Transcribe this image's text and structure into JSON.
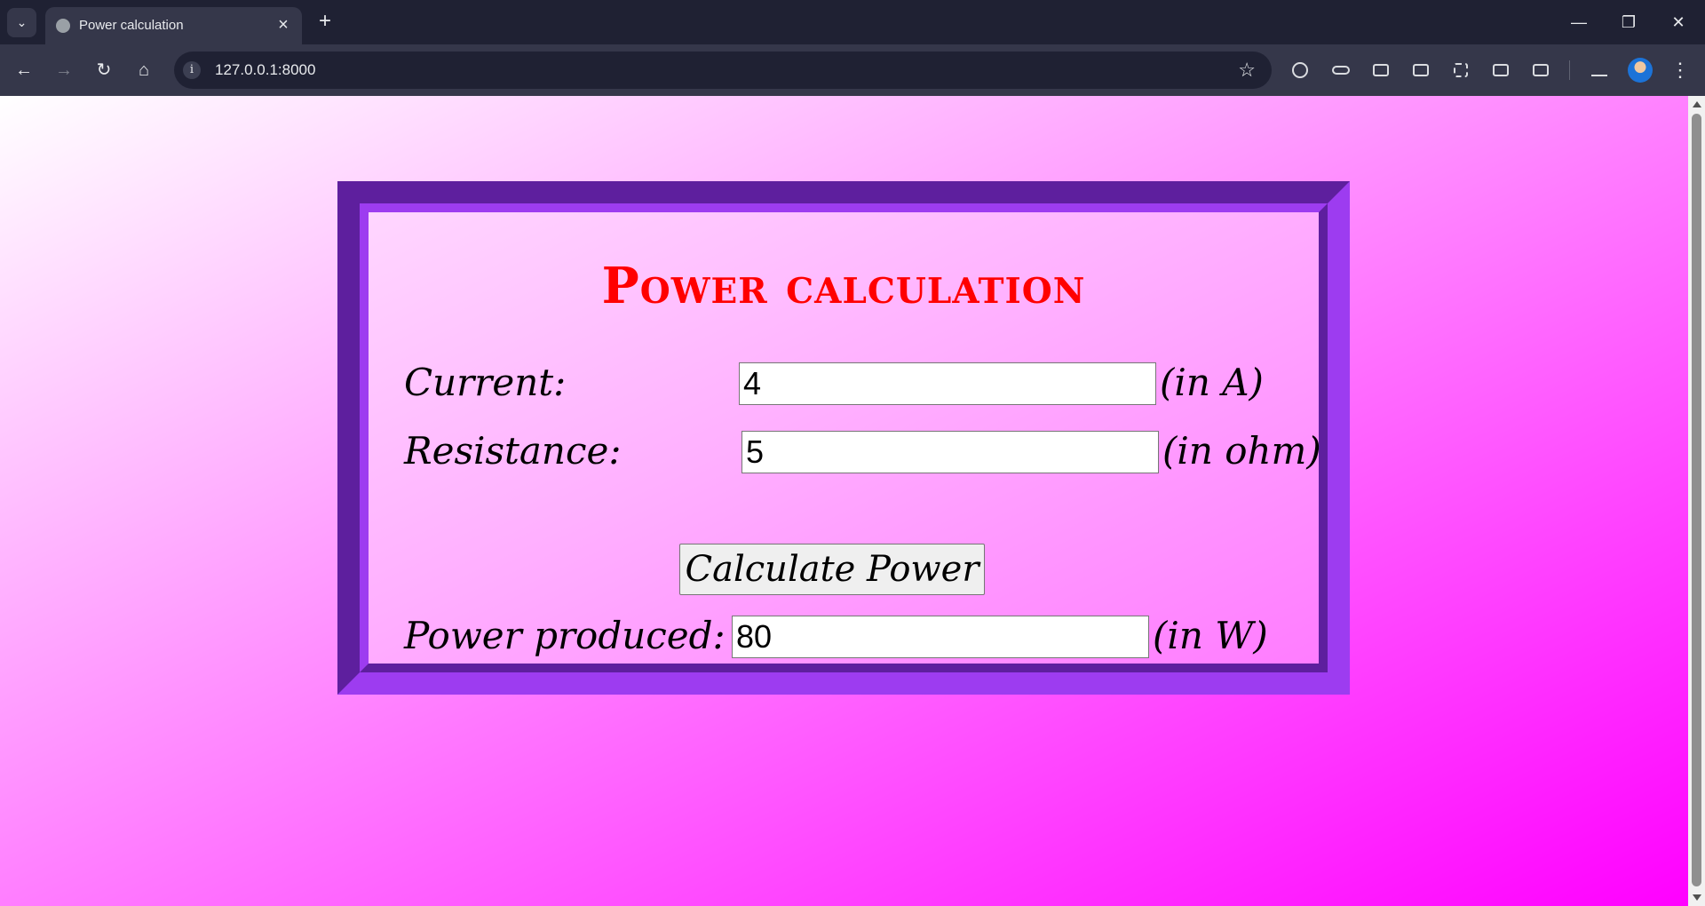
{
  "browser": {
    "tab_title": "Power calculation",
    "url": "127.0.0.1:8000"
  },
  "page": {
    "title": "Power calculation",
    "current": {
      "label": "Current:",
      "value": "4",
      "unit": "(in A)"
    },
    "resistance": {
      "label": "Resistance:",
      "value": "5",
      "unit": "(in ohm)"
    },
    "calculate_button": "Calculate Power",
    "power": {
      "label": "Power produced:",
      "value": "80",
      "unit": "(in W)"
    }
  }
}
